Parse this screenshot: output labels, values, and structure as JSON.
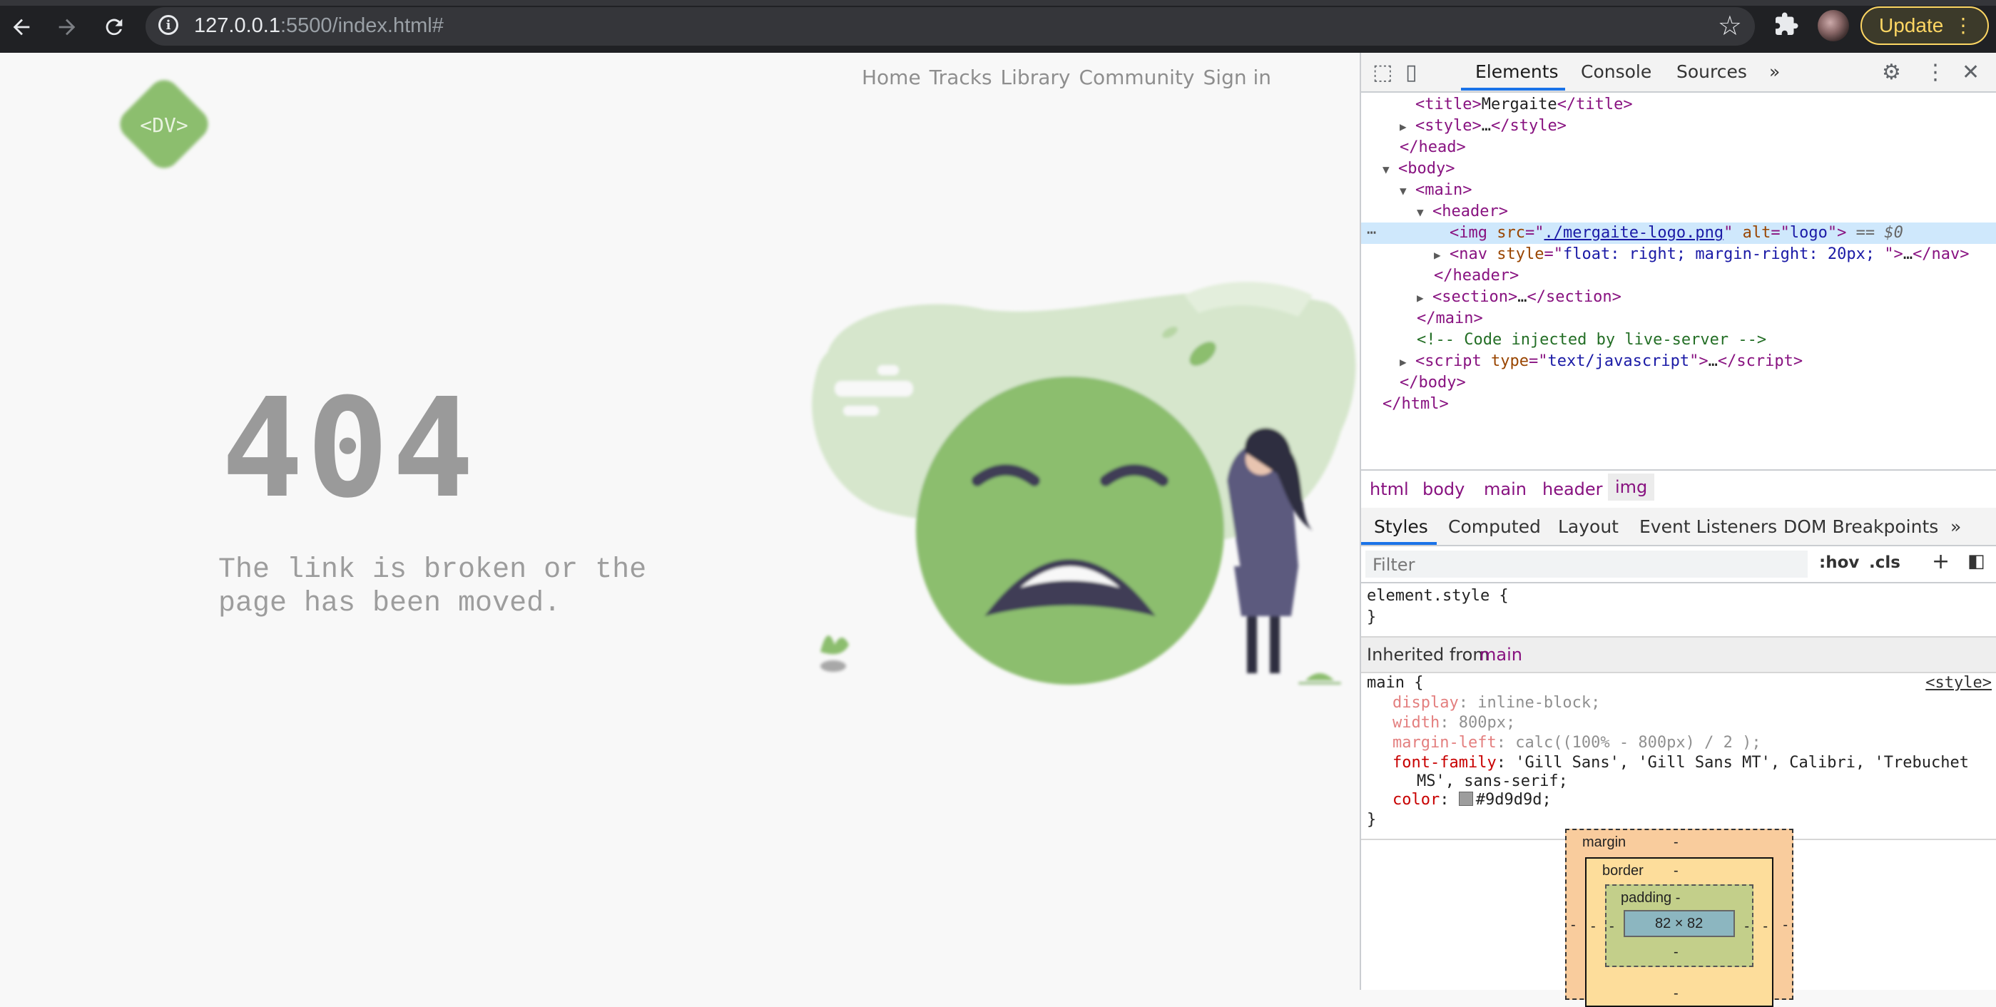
{
  "browser": {
    "url_host": "127.0.0.1",
    "url_rest": ":5500/index.html#",
    "update_label": "Update",
    "icons": [
      "back-arrow-icon",
      "forward-arrow-icon",
      "reload-icon",
      "info-icon",
      "star-icon",
      "extensions-icon",
      "profile-avatar",
      "kebab-menu-icon"
    ]
  },
  "page": {
    "nav": [
      "Home",
      "Tracks",
      "Library",
      "Community",
      "Sign in"
    ],
    "logo_text": "<DV>",
    "error_code": "404",
    "message": "The link is broken or the page has been moved.",
    "colors": {
      "text": "#9d9d9d",
      "accent": "#8cbe6e",
      "bg": "#f8f8f8"
    }
  },
  "devtools": {
    "tabs": [
      "Elements",
      "Console",
      "Sources",
      "»"
    ],
    "dom": {
      "title_text": "Mergaite",
      "img_src": "./mergaite-logo.png",
      "img_alt": "logo",
      "sel_marker": "== $0",
      "nav_style": "float: right; margin-right: 20px; ",
      "comment": "<!-- Code injected by live-server -->",
      "script_type": "text/javascript"
    },
    "breadcrumbs": [
      "html",
      "body",
      "main",
      "header",
      "img"
    ],
    "style_tabs": [
      "Styles",
      "Computed",
      "Layout",
      "Event Listeners",
      "DOM Breakpoints",
      "»"
    ],
    "filter_placeholder": "Filter",
    "filter_tools": [
      ":hov",
      ".cls",
      "+"
    ],
    "element_style": "element.style {",
    "close_brace": "}",
    "inherited_label": "Inherited from",
    "inherited_from": "main",
    "rule": {
      "selector": "main {",
      "source": "<style>",
      "decls": [
        {
          "p": "display",
          "v": "inline-block;",
          "dim": true
        },
        {
          "p": "width",
          "v": "800px;",
          "dim": true
        },
        {
          "p": "margin-left",
          "v": "calc((100% - 800px) / 2 );",
          "dim": true
        },
        {
          "p": "font-family",
          "v": "'Gill Sans', 'Gill Sans MT', Calibri, 'Trebuchet",
          "dim": false
        },
        {
          "p": "",
          "v": "MS', sans-serif;",
          "dim": false
        },
        {
          "p": "color",
          "v": "#9d9d9d;",
          "dim": false
        }
      ]
    },
    "box_model": {
      "margin": "margin",
      "border": "border",
      "padding": "padding -",
      "content": "82 × 82",
      "dash": "-"
    }
  }
}
